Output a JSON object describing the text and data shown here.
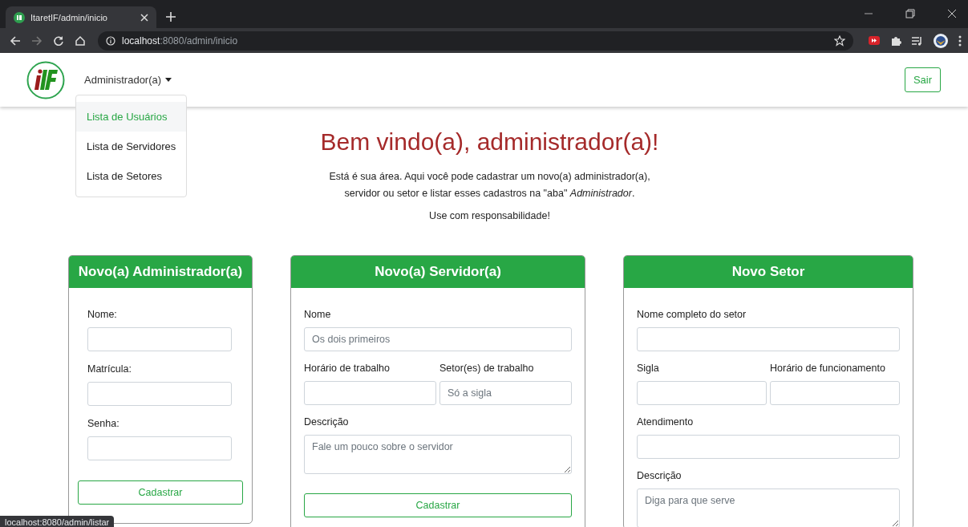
{
  "browser": {
    "tab_title": "ItaretIF/admin/inicio",
    "url_host": "localhost",
    "url_rest": ":8080/admin/inicio"
  },
  "navbar": {
    "menu_label": "Administrador(a)",
    "expanded": true,
    "dropdown": [
      {
        "label": "Lista de Usuários",
        "selected": true
      },
      {
        "label": "Lista de Servidores",
        "selected": false
      },
      {
        "label": "Lista de Setores",
        "selected": false
      }
    ],
    "logout": "Sair"
  },
  "welcome": {
    "title": "Bem vindo(a), administrador(a)!",
    "text": "Está é sua área. Aqui você pode cadastrar um novo(a) administrador(a), servidor ou setor e listar esses cadastros na \"aba\" *Administrador*.",
    "note": "Use com responsabilidade!"
  },
  "cards": [
    {
      "title": "Novo(a) Administrador(a)",
      "rows": [
        [
          {
            "kind": "input",
            "label": "Nome:"
          }
        ],
        [
          {
            "kind": "input",
            "label": "Matrícula:"
          }
        ],
        [
          {
            "kind": "input",
            "label": "Senha:"
          }
        ]
      ],
      "button": "Cadastrar"
    },
    {
      "title": "Novo(a) Servidor(a)",
      "rows": [
        [
          {
            "kind": "input",
            "label": "Nome",
            "placeholder": "Os dois primeiros"
          }
        ],
        [
          {
            "kind": "input",
            "label": "Horário de trabalho"
          },
          {
            "kind": "input",
            "label": "Setor(es) de trabalho",
            "placeholder": "Só a sigla"
          }
        ],
        [
          {
            "kind": "textarea",
            "label": "Descrição",
            "placeholder": "Fale um pouco sobre o servidor"
          }
        ]
      ],
      "button": "Cadastrar"
    },
    {
      "title": "Novo Setor",
      "rows": [
        [
          {
            "kind": "input",
            "label": "Nome completo do setor"
          }
        ],
        [
          {
            "kind": "input",
            "label": "Sigla"
          },
          {
            "kind": "input",
            "label": "Horário de funcionamento"
          }
        ],
        [
          {
            "kind": "input",
            "label": "Atendimento"
          }
        ],
        [
          {
            "kind": "textarea",
            "label": "Descrição",
            "placeholder": "Diga para que serve"
          }
        ]
      ]
    }
  ],
  "status_link": "localhost:8080/admin/listar"
}
